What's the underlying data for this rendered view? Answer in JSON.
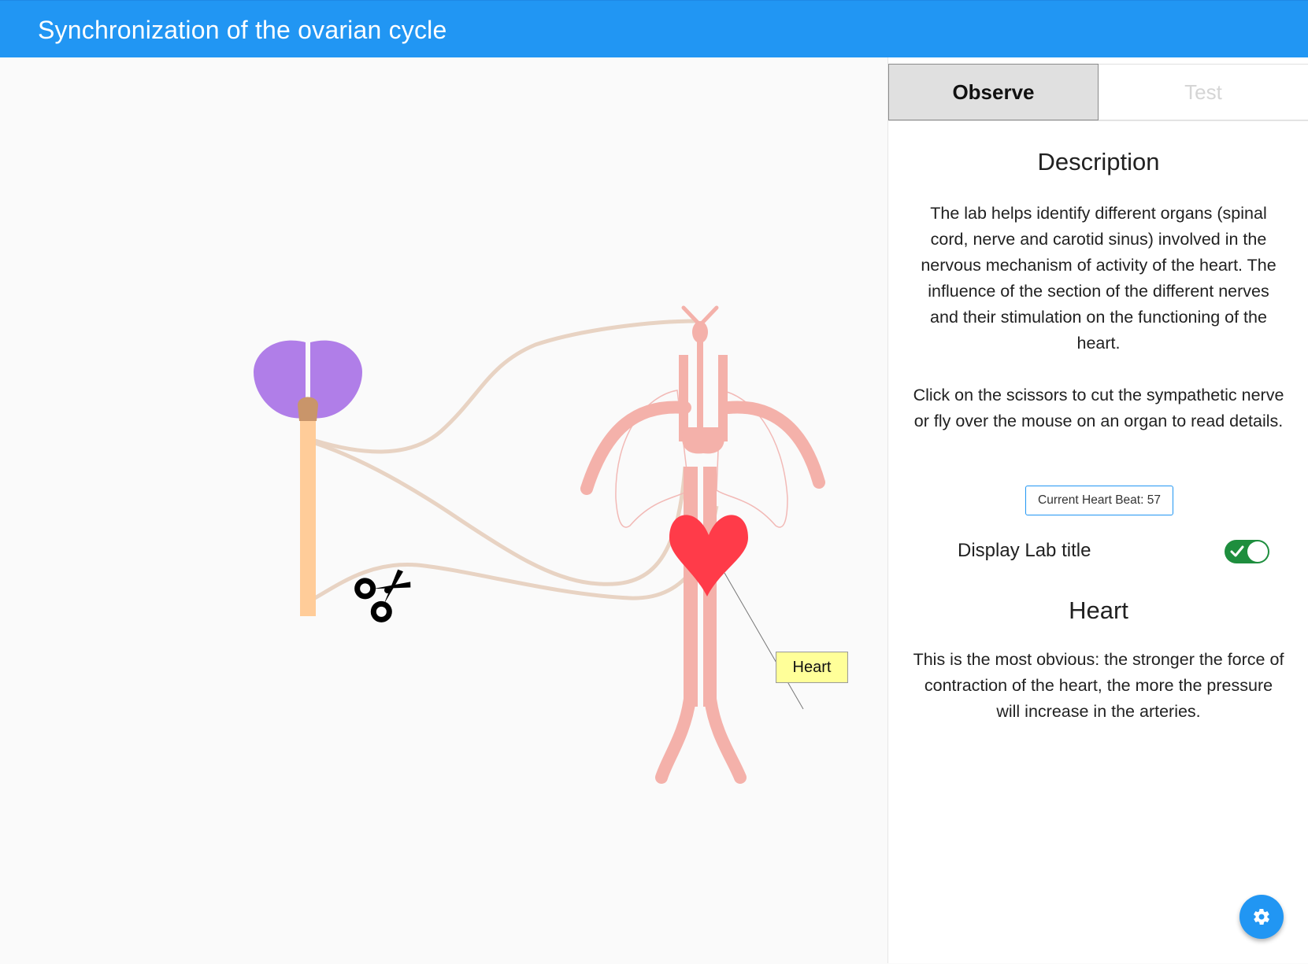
{
  "app": {
    "title": "Synchronization of the ovarian cycle"
  },
  "tabs": [
    {
      "label": "Observe",
      "active": true
    },
    {
      "label": "Test",
      "active": false
    }
  ],
  "description": {
    "title": "Description",
    "paragraph1": "The lab helps identify different organs (spinal cord, nerve and carotid sinus) involved in the nervous mechanism of activity of the heart. The influence of the section of the different nerves and their stimulation on the functioning of the heart.",
    "paragraph2": "Click on the scissors to cut the sympathetic nerve or fly over the mouse on an organ to read details."
  },
  "heart_beat": {
    "text": "Current Heart Beat: 57",
    "value": 57
  },
  "toggle": {
    "label": "Display Lab title",
    "on": true
  },
  "organ_info": {
    "title": "Heart",
    "text": "This is the most obvious: the stronger the force of contraction of the heart, the more the pressure will increase in the arteries."
  },
  "diagram": {
    "tooltip_label": "Heart",
    "colors": {
      "brain": "#b07ee8",
      "cerebellum": "#9d6ea3",
      "brainstem": "#c9956a",
      "spinal_cord": "#ffcc99",
      "nerve": "#e8d3c3",
      "vessels": "#f4b1aa",
      "heart": "#ff3b49",
      "lungs_outline": "#f2b9b6",
      "tooltip_bg": "#ffff99"
    },
    "icons": {
      "scissors": "scissors-icon"
    }
  },
  "colors": {
    "app_bar": "#2196f3",
    "toggle_on": "#1e8e3e",
    "fab": "#2196f3"
  },
  "fab": {
    "icon": "gear-icon"
  }
}
